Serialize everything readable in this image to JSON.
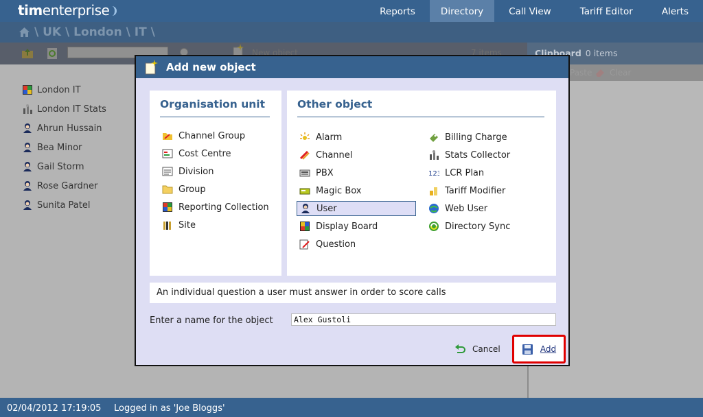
{
  "app": {
    "logo_bold": "tim",
    "logo_rest": "enterprise"
  },
  "nav": [
    "Reports",
    "Directory",
    "Call View",
    "Tariff Editor",
    "Alerts"
  ],
  "nav_active": "Directory",
  "breadcrumb": "\\ UK \\ London \\ IT \\",
  "toolbar": {
    "new_object": "New object",
    "item_count": "7 items"
  },
  "clipboard": {
    "title": "Clipboard",
    "count": "0 items",
    "paste": "Paste",
    "clear": "Clear"
  },
  "tree": [
    {
      "label": "London IT",
      "icon": "reporting-collection-icon"
    },
    {
      "label": "London IT Stats",
      "icon": "stats-collector-icon"
    },
    {
      "label": "Ahrun Hussain",
      "icon": "user-icon"
    },
    {
      "label": "Bea Minor",
      "icon": "user-icon"
    },
    {
      "label": "Gail Storm",
      "icon": "user-icon"
    },
    {
      "label": "Rose Gardner",
      "icon": "user-icon"
    },
    {
      "label": "Sunita Patel",
      "icon": "user-icon"
    }
  ],
  "dialog": {
    "title": "Add new object",
    "org_unit": {
      "title": "Organisation unit",
      "items": [
        {
          "label": "Channel Group",
          "icon": "channel-group-icon"
        },
        {
          "label": "Cost Centre",
          "icon": "cost-centre-icon"
        },
        {
          "label": "Division",
          "icon": "division-icon"
        },
        {
          "label": "Group",
          "icon": "group-folder-icon"
        },
        {
          "label": "Reporting Collection",
          "icon": "reporting-collection-icon"
        },
        {
          "label": "Site",
          "icon": "site-icon"
        }
      ]
    },
    "other": {
      "title": "Other object",
      "col1": [
        {
          "label": "Alarm",
          "icon": "alarm-icon"
        },
        {
          "label": "Channel",
          "icon": "channel-icon"
        },
        {
          "label": "PBX",
          "icon": "pbx-icon"
        },
        {
          "label": "Magic Box",
          "icon": "magic-box-icon"
        },
        {
          "label": "User",
          "icon": "user-icon",
          "selected": true
        },
        {
          "label": "Display Board",
          "icon": "display-board-icon"
        },
        {
          "label": "Question",
          "icon": "question-icon"
        }
      ],
      "col2": [
        {
          "label": "Billing Charge",
          "icon": "billing-charge-icon"
        },
        {
          "label": "Stats Collector",
          "icon": "stats-collector-icon"
        },
        {
          "label": "LCR Plan",
          "icon": "lcr-plan-icon"
        },
        {
          "label": "Tariff Modifier",
          "icon": "tariff-modifier-icon"
        },
        {
          "label": "Web User",
          "icon": "web-user-icon"
        },
        {
          "label": "Directory Sync",
          "icon": "directory-sync-icon"
        }
      ]
    },
    "description": "An individual question a user must answer in order to score calls",
    "name_label": "Enter a name for the object",
    "name_value": "Alex Gustoli",
    "cancel_label": "Cancel",
    "add_label": "Add"
  },
  "footer": {
    "datetime": "02/04/2012 17:19:05",
    "logged_in": "Logged in as 'Joe Bloggs'"
  },
  "colors": {
    "header": "#37628f",
    "highlight_border": "#e00000",
    "dialog_bg": "#dedef4"
  }
}
